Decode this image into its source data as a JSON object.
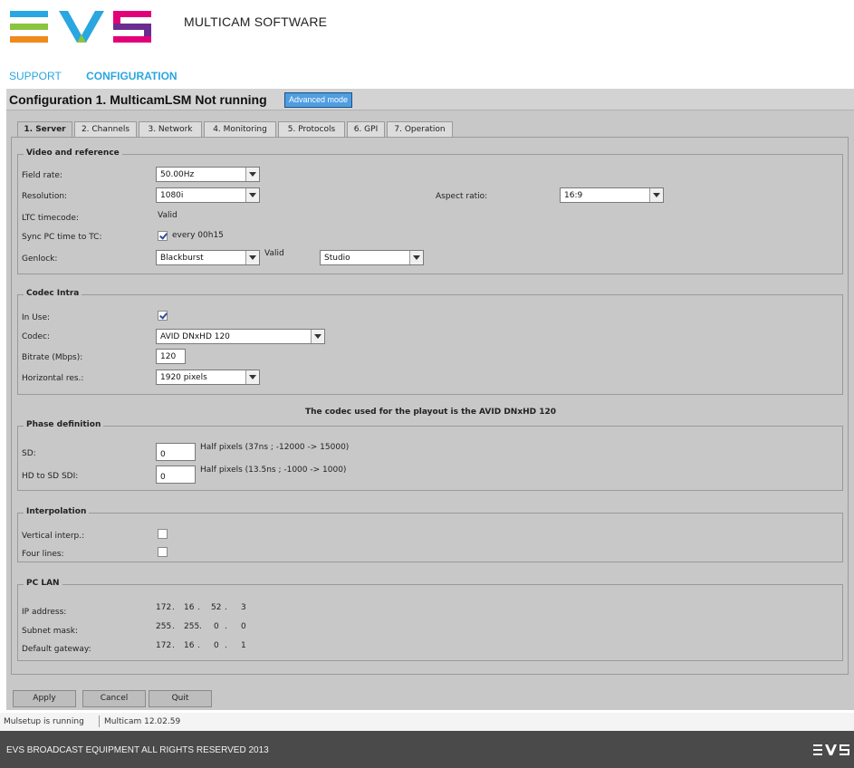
{
  "header": {
    "app_title": "MULTICAM SOFTWARE",
    "nav": [
      "SUPPORT",
      "CONFIGURATION"
    ]
  },
  "panel": {
    "title": "Configuration 1. MulticamLSM Not running",
    "advanced_mode_label": "Advanced mode"
  },
  "tabs": [
    "1. Server",
    "2. Channels",
    "3. Network",
    "4. Monitoring",
    "5. Protocols",
    "6. GPI",
    "7. Operation"
  ],
  "video": {
    "legend": "Video and reference",
    "field_rate_label": "Field rate:",
    "field_rate_value": "50.00Hz",
    "resolution_label": "Resolution:",
    "resolution_value": "1080i",
    "aspect_label": "Aspect ratio:",
    "aspect_value": "16:9",
    "ltc_label": "LTC timecode:",
    "ltc_value": "Valid",
    "sync_label": "Sync PC time to TC:",
    "sync_checked": true,
    "sync_value": "every 00h15",
    "genlock_label": "Genlock:",
    "genlock_value": "Blackburst",
    "genlock_status": "Valid",
    "genlock_mode": "Studio"
  },
  "codec": {
    "legend": "Codec Intra",
    "in_use_label": "In Use:",
    "in_use_checked": true,
    "codec_label": "Codec:",
    "codec_value": "AVID DNxHD 120",
    "bitrate_label": "Bitrate (Mbps):",
    "bitrate_value": "120",
    "hres_label": "Horizontal res.:",
    "hres_value": "1920 pixels",
    "playout_note": "The codec used for the playout is the AVID DNxHD 120"
  },
  "phase": {
    "legend": "Phase definition",
    "sd_label": "SD:",
    "sd_value": "0",
    "sd_hint": "Half pixels (37ns ; -12000 -> 15000)",
    "hd_label": "HD to SD SDI:",
    "hd_value": "0",
    "hd_hint": "Half pixels (13.5ns ; -1000 -> 1000)"
  },
  "interp": {
    "legend": "Interpolation",
    "vertical_label": "Vertical interp.:",
    "vertical_checked": false,
    "four_label": "Four lines:",
    "four_checked": false
  },
  "lan": {
    "legend": "PC LAN",
    "ip_label": "IP address:",
    "ip": [
      "172",
      "16",
      "52",
      "3"
    ],
    "mask_label": "Subnet mask:",
    "mask": [
      "255",
      "255",
      "0",
      "0"
    ],
    "gw_label": "Default gateway:",
    "gw": [
      "172",
      "16",
      "0",
      "1"
    ]
  },
  "buttons": {
    "apply": "Apply",
    "cancel": "Cancel",
    "quit": "Quit"
  },
  "status": {
    "left": "Mulsetup is running",
    "right": "Multicam 12.02.59"
  },
  "footer": {
    "copyright": "EVS BROADCAST EQUIPMENT ALL RIGHTS RESERVED 2013"
  },
  "colors": {
    "nav_link": "#2aa6e0",
    "panel_bg": "#c8c8c8",
    "advanced_button": "#4f9ee0",
    "footer_bg": "#4a4a4a",
    "logo_colors": [
      "#f08a1c",
      "#2aa6e0",
      "#8bc53f",
      "#e2007a",
      "#6a2c91"
    ]
  }
}
